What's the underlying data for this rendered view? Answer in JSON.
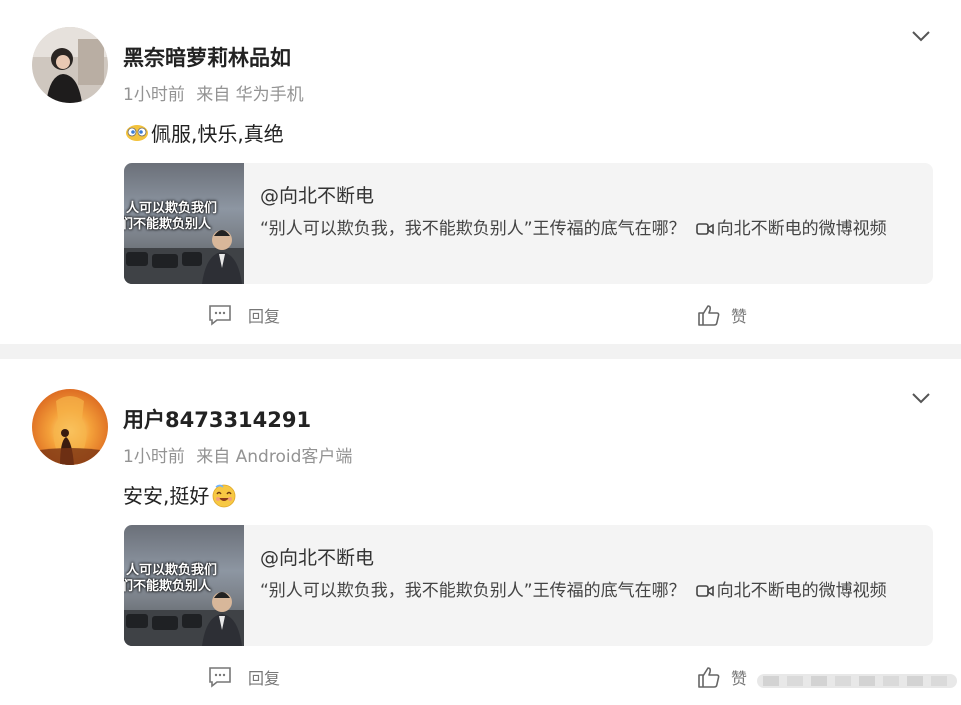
{
  "comments": [
    {
      "username": "黑奈暗萝莉林品如",
      "time": "1小时前",
      "source": "来自 华为手机",
      "text_before": "",
      "text": "佩服,快乐,真绝",
      "emoji": "eyes-lip-emoji",
      "quote": {
        "author": "@向北不断电",
        "body_main": "“别人可以欺负我，我不能欺负别人”王传福的底气在哪？",
        "video_label": "向北不断电的微博视频",
        "thumb_line1": "人可以欺负我们",
        "thumb_line2": "们不能欺负别人"
      },
      "reply_label": "回复",
      "like_label": "赞"
    },
    {
      "username": "用户8473314291",
      "time": "1小时前",
      "source": "来自 Android客户端",
      "text": "安安,挺好",
      "emoji": "heart-eyes-face-emoji",
      "quote": {
        "author": "@向北不断电",
        "body_main": "“别人可以欺负我，我不能欺负别人”王传福的底气在哪？",
        "video_label": "向北不断电的微博视频",
        "thumb_line1": "人可以欺负我们",
        "thumb_line2": "们不能欺负别人"
      },
      "reply_label": "回复",
      "like_label": "赞"
    }
  ],
  "colors": {
    "page_bg": "#f2f2f2",
    "card_bg": "#ffffff",
    "quote_bg": "#f4f4f4",
    "meta_text": "#939393"
  }
}
